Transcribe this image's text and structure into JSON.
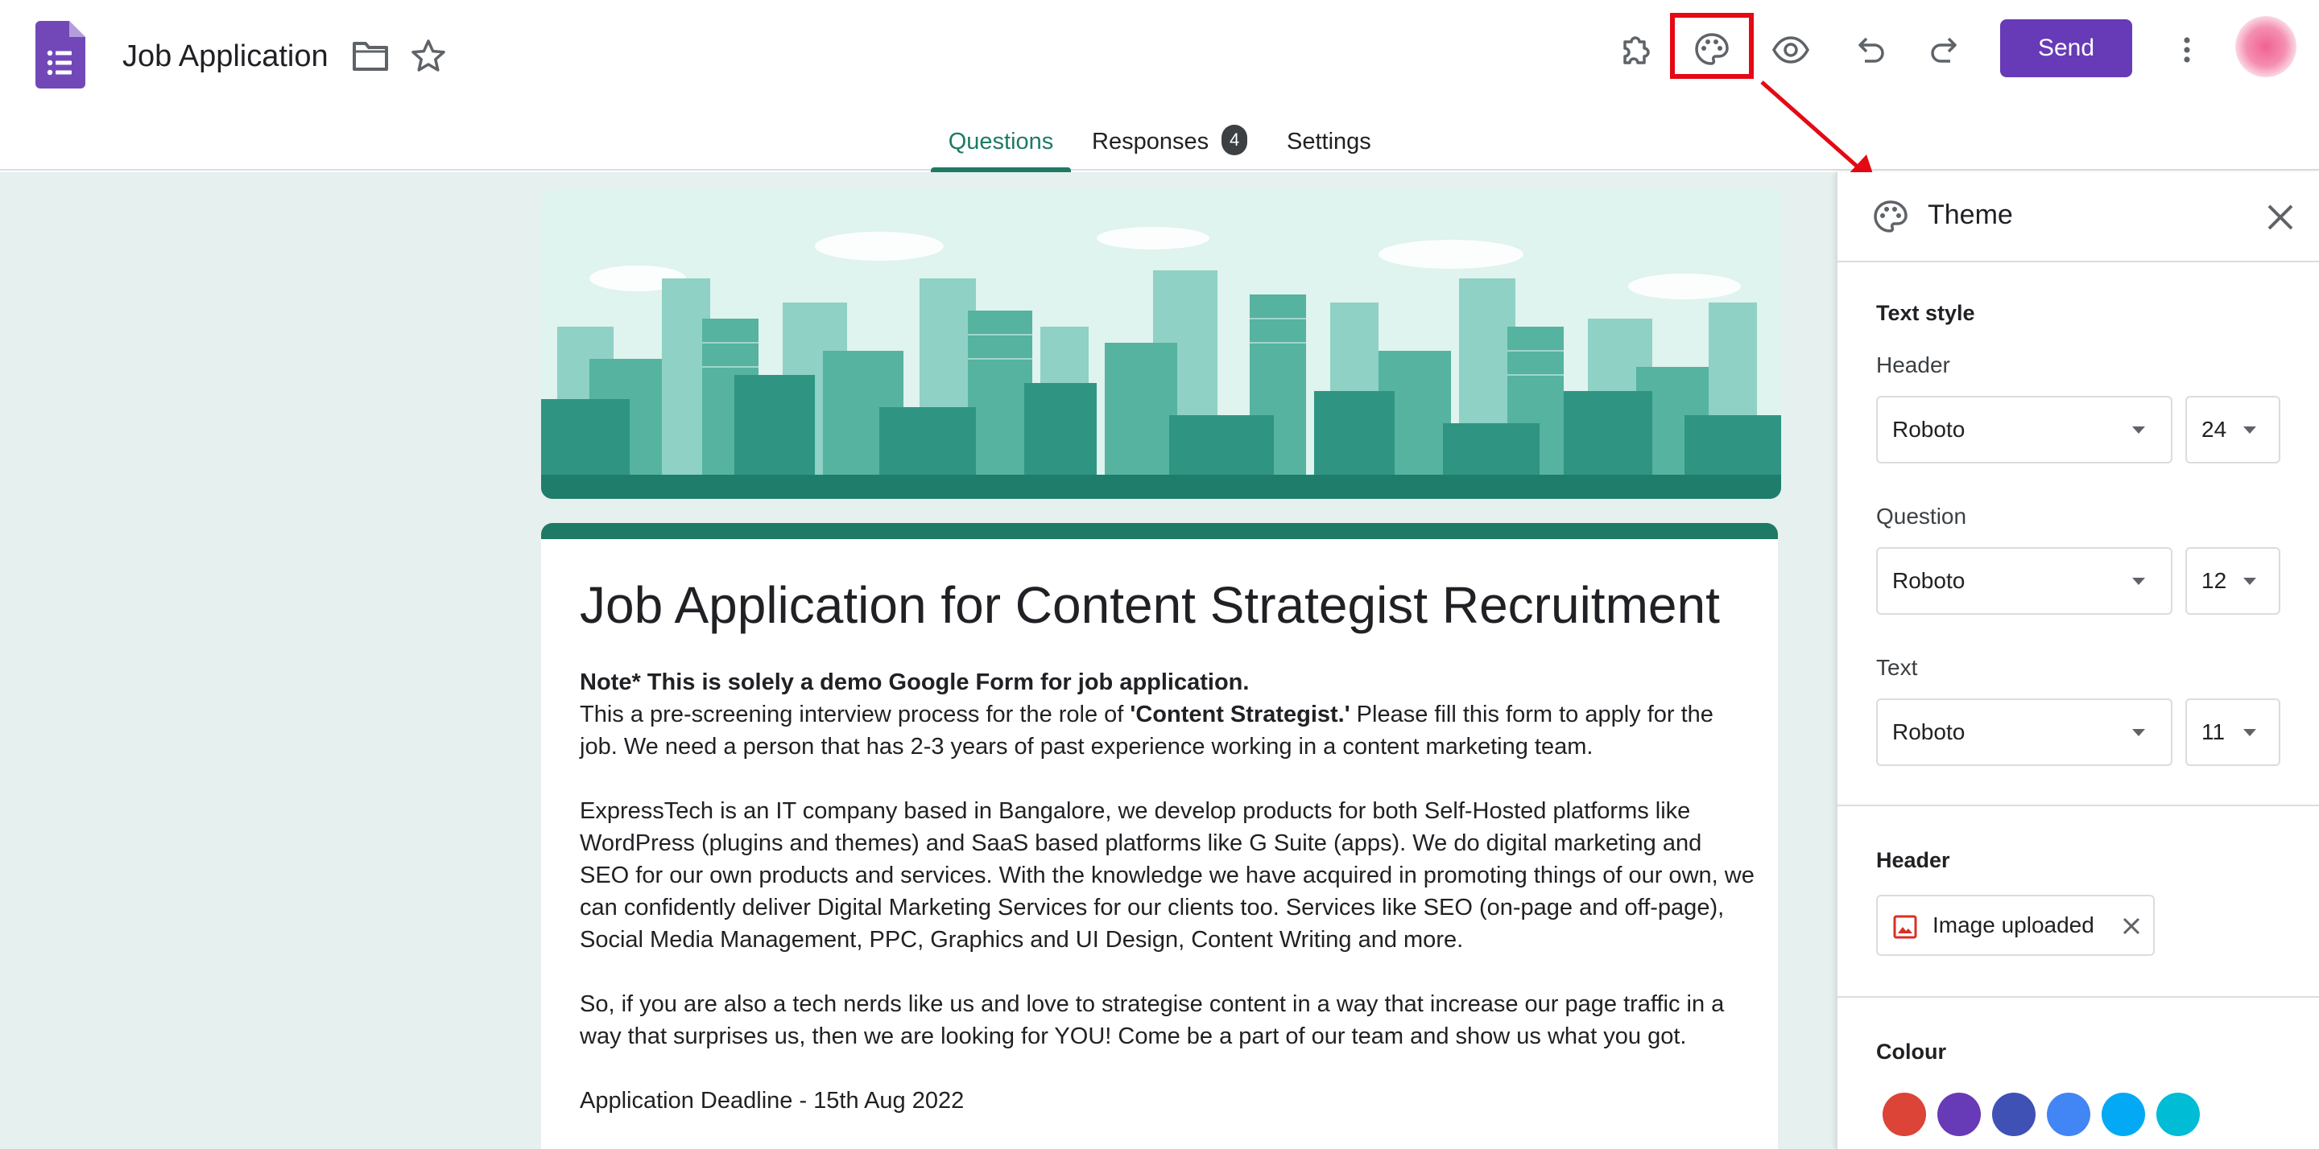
{
  "header": {
    "doc_title": "Job Application",
    "send_label": "Send",
    "icons": [
      "forms-logo-icon",
      "folder-icon",
      "star-icon",
      "addon-puzzle-icon",
      "palette-icon",
      "preview-eye-icon",
      "undo-icon",
      "redo-icon",
      "more-vert-icon"
    ],
    "accent_color": "#673ab7"
  },
  "tabs": [
    {
      "label": "Questions",
      "active": true
    },
    {
      "label": "Responses",
      "badge": "4"
    },
    {
      "label": "Settings"
    }
  ],
  "form": {
    "title": "Job Application for Content Strategist Recruitment",
    "note": "Note* This is solely a demo Google Form for job application.",
    "intro_before": "This a pre-screening interview process for the role of ",
    "intro_bold": "'Content Strategist.'",
    "intro_after": " Please fill this form to apply for the job. We need a person that has 2-3 years of past experience working in a content marketing team.",
    "paragraph_company": "ExpressTech is an IT company based in Bangalore, we develop products for both Self-Hosted platforms like WordPress (plugins and themes) and SaaS based platforms like G Suite (apps). We do digital marketing and SEO for our own products and services. With the knowledge we have acquired in promoting things of our own, we can confidently deliver Digital Marketing Services for our clients too. Services like SEO (on-page and off-page), Social Media Management, PPC, Graphics and UI Design, Content Writing and more.",
    "paragraph_invite": "So, if you are also a tech nerds like us and love to strategise content in a way that increase our page traffic in a way that surprises us, then we are looking for YOU! Come be a part of our team and show us what you got.",
    "deadline": "Application Deadline - 15th Aug 2022",
    "theme_color": "#1e7a64"
  },
  "theme_panel": {
    "title": "Theme",
    "text_style_title": "Text style",
    "header_label": "Header",
    "header_font": "Roboto",
    "header_size": "24",
    "question_label": "Question",
    "question_font": "Roboto",
    "question_size": "12",
    "text_label": "Text",
    "text_font": "Roboto",
    "text_size": "11",
    "header_section_title": "Header",
    "image_chip_label": "Image uploaded",
    "colour_title": "Colour",
    "colours": [
      "#db4437",
      "#673ab7",
      "#3f51b5",
      "#4285f4",
      "#03a9f4",
      "#00bcd4"
    ]
  }
}
